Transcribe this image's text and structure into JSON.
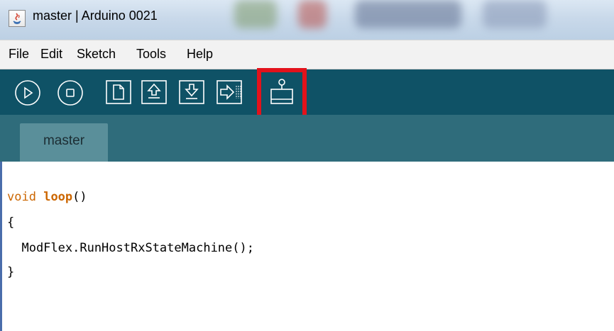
{
  "window": {
    "title": "master | Arduino 0021",
    "icon": "java-app-icon"
  },
  "menu": {
    "items": [
      "File",
      "Edit",
      "Sketch",
      "Tools",
      "Help"
    ]
  },
  "toolbar": {
    "buttons": [
      {
        "name": "verify",
        "icon": "play-icon"
      },
      {
        "name": "stop",
        "icon": "stop-icon"
      },
      {
        "name": "new",
        "icon": "new-file-icon"
      },
      {
        "name": "open",
        "icon": "open-arrow-up-icon"
      },
      {
        "name": "save",
        "icon": "save-arrow-down-icon"
      },
      {
        "name": "upload",
        "icon": "upload-arrow-right-icon"
      },
      {
        "name": "serial-monitor",
        "icon": "serial-monitor-icon",
        "highlighted": true
      }
    ],
    "highlight_color": "#e3121b"
  },
  "tabs": [
    {
      "label": "master",
      "active": true
    }
  ],
  "editor": {
    "line1": {
      "kw": "void",
      "space": " ",
      "fn": "loop",
      "rest": "()"
    },
    "line2": "{",
    "line3": "  ModFlex.RunHostRxStateMachine();",
    "line4": "}"
  },
  "colors": {
    "toolbar_bg": "#0f5266",
    "tabbar_bg": "#2f6c7b",
    "tab_bg": "#5a8f9a",
    "keyword": "#cc6600"
  }
}
